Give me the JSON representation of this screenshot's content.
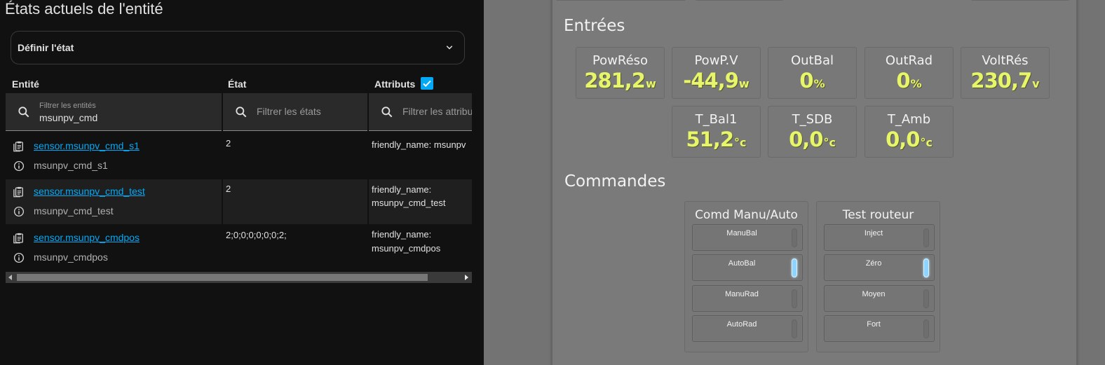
{
  "ha": {
    "title": "États actuels de l'entité",
    "set_state_label": "Définir l'état",
    "columns": {
      "entity": "Entité",
      "state": "État",
      "attributes": "Attributs"
    },
    "attributes_checked": true,
    "filters": {
      "entity": {
        "label": "Filtrer les entités",
        "value": "msunpv_cmd"
      },
      "state": {
        "placeholder": "Filtrer les états"
      },
      "attributes": {
        "placeholder": "Filtrer les attributs"
      }
    },
    "rows": [
      {
        "entity_id": "sensor.msunpv_cmd_s1",
        "name": "msunpv_cmd_s1",
        "state": "2",
        "attr1": "friendly_name: msunpv",
        "attr2": ""
      },
      {
        "entity_id": "sensor.msunpv_cmd_test",
        "name": "msunpv_cmd_test",
        "state": "2",
        "attr1": "friendly_name:",
        "attr2": "msunpv_cmd_test"
      },
      {
        "entity_id": "sensor.msunpv_cmdpos",
        "name": "msunpv_cmdpos",
        "state": "2;0;0;0;0;0;0;2;",
        "attr1": "friendly_name:",
        "attr2": "msunpv_cmdpos"
      }
    ]
  },
  "dash": {
    "inputs_title": "Entrées",
    "commands_title": "Commandes",
    "tiles": [
      {
        "label": "PowRéso",
        "value": "281,2",
        "unit": "w"
      },
      {
        "label": "PowP.V",
        "value": "-44,9",
        "unit": "w"
      },
      {
        "label": "OutBal",
        "value": "0",
        "unit": "%"
      },
      {
        "label": "OutRad",
        "value": "0",
        "unit": "%"
      },
      {
        "label": "VoltRés",
        "value": "230,7",
        "unit": "v"
      },
      {
        "label": "T_Bal1",
        "value": "51,2",
        "unit": "°c"
      },
      {
        "label": "T_SDB",
        "value": "0,0",
        "unit": "°c"
      },
      {
        "label": "T_Amb",
        "value": "0,0",
        "unit": "°c"
      }
    ],
    "cmd_groups": [
      {
        "title": "Comd Manu/Auto",
        "buttons": [
          {
            "label": "ManuBal",
            "active": false
          },
          {
            "label": "AutoBal",
            "active": true
          },
          {
            "label": "ManuRad",
            "active": false
          },
          {
            "label": "AutoRad",
            "active": false
          }
        ]
      },
      {
        "title": "Test routeur",
        "buttons": [
          {
            "label": "Inject",
            "active": false
          },
          {
            "label": "Zéro",
            "active": true
          },
          {
            "label": "Moyen",
            "active": false
          },
          {
            "label": "Fort",
            "active": false
          }
        ]
      }
    ],
    "colors": {
      "value_yellow": "#e6f56a",
      "indicator_on": "#8fd3ff",
      "link": "#03a9f4"
    }
  }
}
